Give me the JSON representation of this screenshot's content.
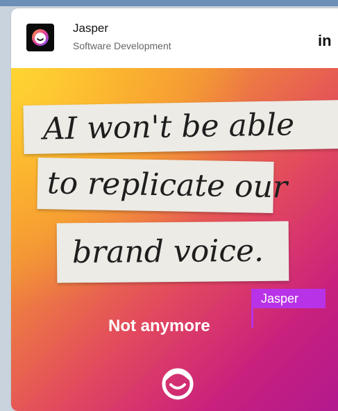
{
  "post": {
    "company_name": "Jasper",
    "industry": "Software Development",
    "platform_logo": "in"
  },
  "hero": {
    "note_line_1": "AI won't be able",
    "note_line_2": "to replicate our",
    "note_line_3": "brand voice.",
    "name_tag": "Jasper",
    "headline": "Not anymore"
  },
  "colors": {
    "tag_purple": "#b832e8",
    "gradient_start": "#fcb63a",
    "gradient_end": "#b1198f"
  },
  "icons": {
    "company_logo": "jasper-logo-icon",
    "platform": "linkedin-icon",
    "bottom_mark": "jasper-mascot-icon"
  }
}
